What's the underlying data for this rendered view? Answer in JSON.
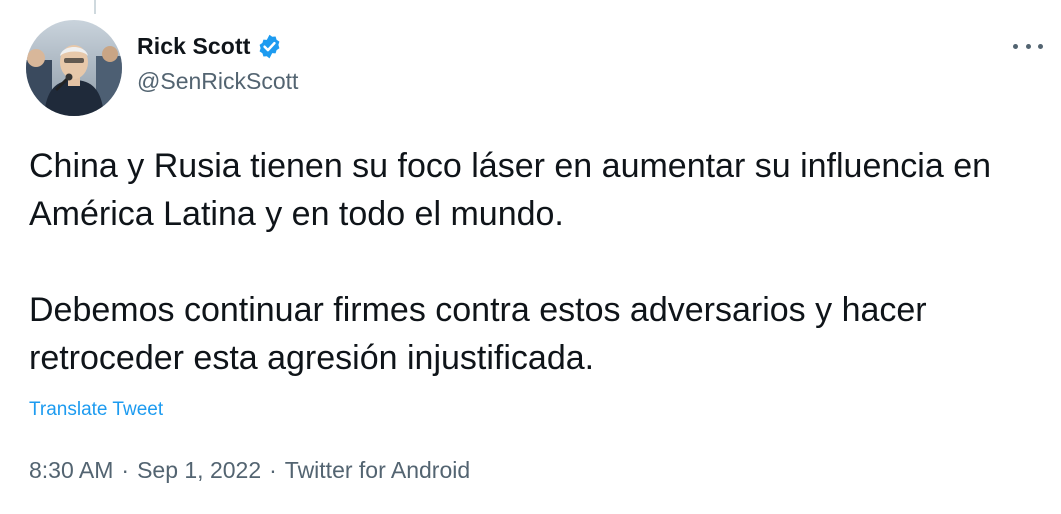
{
  "author": {
    "name": "Rick Scott",
    "handle": "@SenRickScott",
    "verified": true,
    "verified_color": "#1d9bf0",
    "avatar_icon": "profile-photo"
  },
  "tweet": {
    "paragraphs": [
      "China y Rusia tienen su foco láser en aumentar su influencia en América Latina y en todo el mundo.",
      "Debemos continuar firmes contra estos adversarios y hacer retroceder esta agresión injustificada."
    ],
    "translate_label": "Translate Tweet",
    "time": "8:30 AM",
    "date": "Sep 1, 2022",
    "source": "Twitter for Android",
    "separator": "·"
  },
  "colors": {
    "text": "#0f1419",
    "secondary": "#536471",
    "link": "#1d9bf0"
  }
}
